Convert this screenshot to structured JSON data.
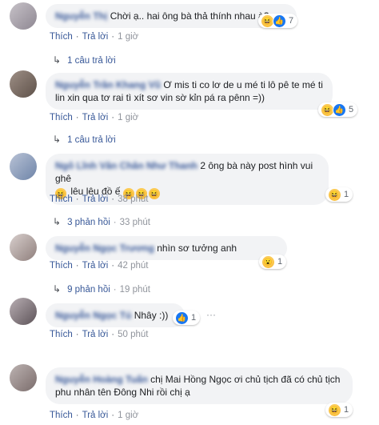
{
  "actions": {
    "like": "Thích",
    "reply": "Trả lời"
  },
  "comments": [
    {
      "name": "Nguyễn Thị",
      "text": "Chời ạ.. hai ông bà thả thính nhau à?",
      "time": "1 giờ",
      "reactions": "7",
      "replies": "1 câu trả lời",
      "reply_time": ""
    },
    {
      "name": "Nguyễn Trần Khang Vũ",
      "text": "Ơ mis ti co lơ de u mé ti lô pê te mé ti lin xin qua tơ rai tì xít sơ vin sờ kỉn pá ra pênn =))",
      "time": "1 giờ",
      "reactions": "5",
      "replies": "1 câu trả lời",
      "reply_time": ""
    },
    {
      "name": "Ngô Lĩnh Vân Chân Như Thanh",
      "text": "2 ông bà này post hình vui ghê",
      "text2": "lêu lêu đồ ế",
      "time": "38 phút",
      "reactions": "1",
      "replies": "3 phản hồi",
      "reply_time": "33 phút"
    },
    {
      "name": "Nguyễn Ngọc Trương",
      "text": "nhìn sơ tưởng anh",
      "time": "42 phút",
      "reactions": "1",
      "replies": "9 phản hồi",
      "reply_time": "19 phút"
    },
    {
      "name": "Nguyễn Ngọc Tú",
      "text": "Nhây :))",
      "time": "50 phút",
      "reactions": "1",
      "replies": "",
      "reply_time": ""
    },
    {
      "name": "Nguyễn Hoàng Tuấn",
      "text": "chị Mai Hồng Ngọc ơi chủ tịch đã có chủ tịch phu nhân tên Đông Nhi rồi chị ạ",
      "time": "1 giờ",
      "reactions": "1",
      "replies": "",
      "reply_time": ""
    }
  ],
  "icons": {
    "reply_arrow": "reply-arrow-icon",
    "haha": "haha-icon",
    "like": "like-icon",
    "wow": "wow-icon"
  }
}
